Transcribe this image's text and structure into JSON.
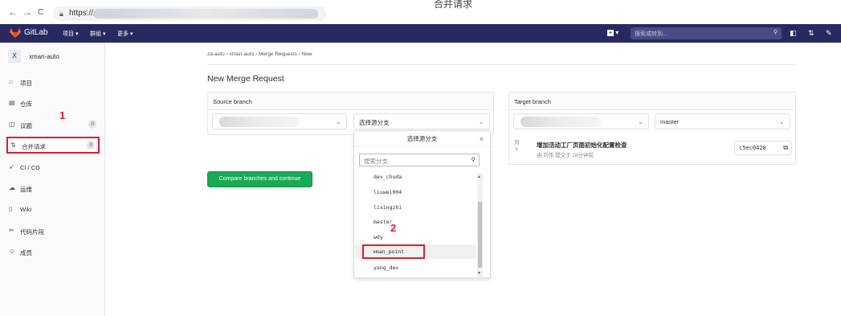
{
  "browser": {
    "back": "←",
    "forward": "→",
    "reload": "C",
    "url_prefix": "https://",
    "window_title": "合并请求"
  },
  "topnav": {
    "brand": "GitLab",
    "projects": "项目 ▾",
    "groups": "群组 ▾",
    "more": "更多 ▾",
    "new_menu": "▾",
    "search_placeholder": "搜索或转到..."
  },
  "sidebar": {
    "project_avatar": "X",
    "project_name": "xman-auto",
    "items": [
      {
        "icon": "home-icon",
        "glyph": "⌂",
        "label": "项目"
      },
      {
        "icon": "repo-icon",
        "glyph": "▤",
        "label": "仓库"
      },
      {
        "icon": "issues-icon",
        "glyph": "◫",
        "label": "议题",
        "count": "0"
      },
      {
        "icon": "merge-request-icon",
        "glyph": "⇅",
        "label": "合并请求",
        "count": "0"
      },
      {
        "icon": "rocket-icon",
        "glyph": "➶",
        "label": "CI / CD"
      },
      {
        "icon": "ops-icon",
        "glyph": "☁",
        "label": "运维"
      },
      {
        "icon": "book-icon",
        "glyph": "▯",
        "label": "Wiki"
      },
      {
        "icon": "snippet-icon",
        "glyph": "✂",
        "label": "代码片段"
      },
      {
        "icon": "users-icon",
        "glyph": "☺",
        "label": "成员"
      }
    ]
  },
  "annotations": {
    "one": "1",
    "two": "2"
  },
  "breadcrumbs": {
    "a": "za-auto",
    "b": "xman-auto",
    "c": "Merge Requests",
    "d": "New",
    "sep": "›"
  },
  "page_title": "New Merge Request",
  "source": {
    "header": "Source branch",
    "branch_select": "选择源分支"
  },
  "target": {
    "header": "Target branch",
    "branch_select": "master"
  },
  "commit": {
    "avatar_alt": "刘\n’s",
    "message": "增加活动工厂页面初始化配置检查",
    "meta": "由 刘伟 提交于 28分钟前",
    "sha": "c5ec0428",
    "copy_icon": "⧉"
  },
  "compare_button": "Compare branches and continue",
  "branch_menu": {
    "title": "选择源分支",
    "close": "×",
    "search_placeholder": "搜索分支",
    "items": [
      "dev_chuda",
      "liuwei004",
      "lixingzhi",
      "master",
      "wdy",
      "xman_point",
      "yang_dev"
    ],
    "selected": "xman_point"
  },
  "colors": {
    "navbar": "#292961",
    "green": "#1aaa55",
    "highlight_box": "#dd1e2f"
  }
}
